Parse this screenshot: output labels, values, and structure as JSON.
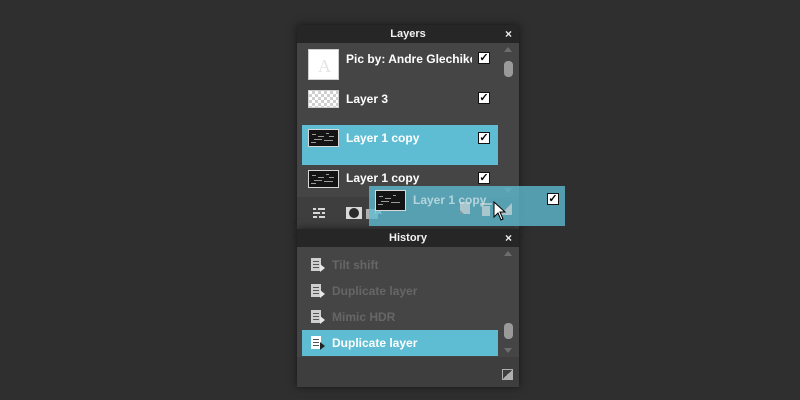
{
  "layers_panel": {
    "title": "Layers",
    "close": "×",
    "layers": [
      {
        "name": "Pic by: Andre Glechikov",
        "visible": true,
        "selected": false,
        "thumb": "white"
      },
      {
        "name": "Layer 3",
        "visible": true,
        "selected": false,
        "thumb": "checker"
      },
      {
        "name": "Layer 1 copy",
        "visible": true,
        "selected": true,
        "thumb": "dark"
      },
      {
        "name": "Layer 1 copy",
        "visible": true,
        "selected": false,
        "thumb": "dark"
      }
    ],
    "toolbar_icons": [
      "adjustments-icon",
      "mask-icon",
      "layer-style-icon",
      "new-layer-icon",
      "trash-icon",
      "resize-icon"
    ]
  },
  "drag_ghost": {
    "name": "Layer 1 copy",
    "visible": true
  },
  "history_panel": {
    "title": "History",
    "close": "×",
    "items": [
      {
        "label": "Tilt shift",
        "selected": false
      },
      {
        "label": "Duplicate layer",
        "selected": false
      },
      {
        "label": "Mimic HDR",
        "selected": false
      },
      {
        "label": "Duplicate layer",
        "selected": true
      }
    ]
  },
  "colors": {
    "background": "#2f2f2f",
    "panel": "#454545",
    "header": "#262626",
    "selection": "#5fbdd3"
  }
}
